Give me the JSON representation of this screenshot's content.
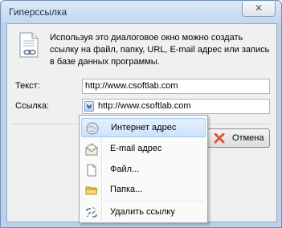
{
  "window": {
    "title": "Гиперссылка",
    "close_glyph": "✕"
  },
  "dialog": {
    "description": "Используя это диалоговое окно можно создать ссылку на файл, папку, URL, E-mail адрес или запись в базе данных программы.",
    "text_label": "Текст:",
    "text_value": "http://www.csoftlab.com",
    "link_label": "Ссылка:",
    "link_value": "http://www.csoftlab.com",
    "cancel_label": "Отмена"
  },
  "menu": {
    "items": [
      {
        "label": "Интернет адрес",
        "icon": "globe-icon",
        "highlighted": true
      },
      {
        "label": "E-mail адрес",
        "icon": "envelope-icon"
      },
      {
        "label": "Файл...",
        "icon": "file-icon"
      },
      {
        "label": "Папка...",
        "icon": "folder-icon"
      },
      {
        "label": "Удалить ссылку",
        "icon": "broken-link-icon"
      }
    ]
  },
  "colors": {
    "highlight": "#cce2fb",
    "cancel_icon": "#e0523f"
  }
}
